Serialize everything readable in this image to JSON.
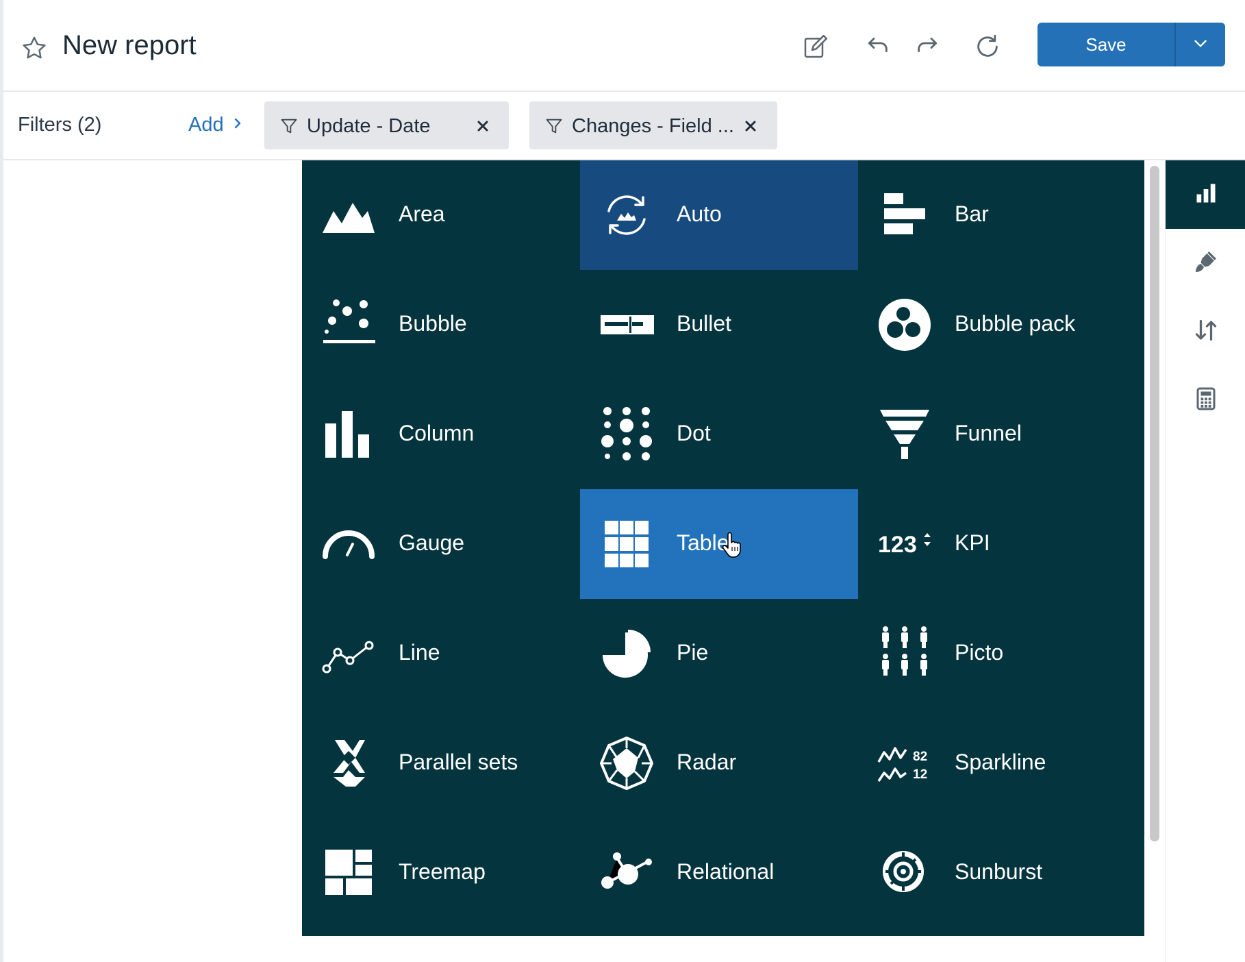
{
  "header": {
    "title": "New report",
    "save_label": "Save"
  },
  "filters": {
    "label": "Filters (2)",
    "add_label": "Add",
    "chips": [
      {
        "label": "Update - Date"
      },
      {
        "label": "Changes - Field ..."
      }
    ]
  },
  "chart_types": [
    {
      "label": "Area",
      "icon": "area-chart-icon"
    },
    {
      "label": "Auto",
      "icon": "auto-chart-icon",
      "state": "selected"
    },
    {
      "label": "Bar",
      "icon": "bar-chart-icon"
    },
    {
      "label": "Bubble",
      "icon": "bubble-chart-icon"
    },
    {
      "label": "Bullet",
      "icon": "bullet-chart-icon"
    },
    {
      "label": "Bubble pack",
      "icon": "bubble-pack-icon"
    },
    {
      "label": "Column",
      "icon": "column-chart-icon"
    },
    {
      "label": "Dot",
      "icon": "dot-chart-icon"
    },
    {
      "label": "Funnel",
      "icon": "funnel-chart-icon"
    },
    {
      "label": "Gauge",
      "icon": "gauge-chart-icon"
    },
    {
      "label": "Table",
      "icon": "table-chart-icon",
      "state": "hovered"
    },
    {
      "label": "KPI",
      "icon": "kpi-icon"
    },
    {
      "label": "Line",
      "icon": "line-chart-icon"
    },
    {
      "label": "Pie",
      "icon": "pie-chart-icon"
    },
    {
      "label": "Picto",
      "icon": "picto-chart-icon"
    },
    {
      "label": "Parallel sets",
      "icon": "parallel-sets-icon"
    },
    {
      "label": "Radar",
      "icon": "radar-chart-icon"
    },
    {
      "label": "Sparkline",
      "icon": "sparkline-icon"
    },
    {
      "label": "Treemap",
      "icon": "treemap-icon"
    },
    {
      "label": "Relational",
      "icon": "relational-chart-icon"
    },
    {
      "label": "Sunburst",
      "icon": "sunburst-chart-icon"
    }
  ],
  "icon_text": {
    "kpi": "123",
    "sparkline_top": "82",
    "sparkline_bottom": "12"
  },
  "right_panel": [
    "chart-type-icon",
    "paintbrush-icon",
    "sort-icon",
    "calculator-icon"
  ],
  "colors": {
    "picker_bg": "#04343e",
    "auto_selected": "#174a7e",
    "table_hover": "#2273bb",
    "accent": "#2471b8"
  }
}
